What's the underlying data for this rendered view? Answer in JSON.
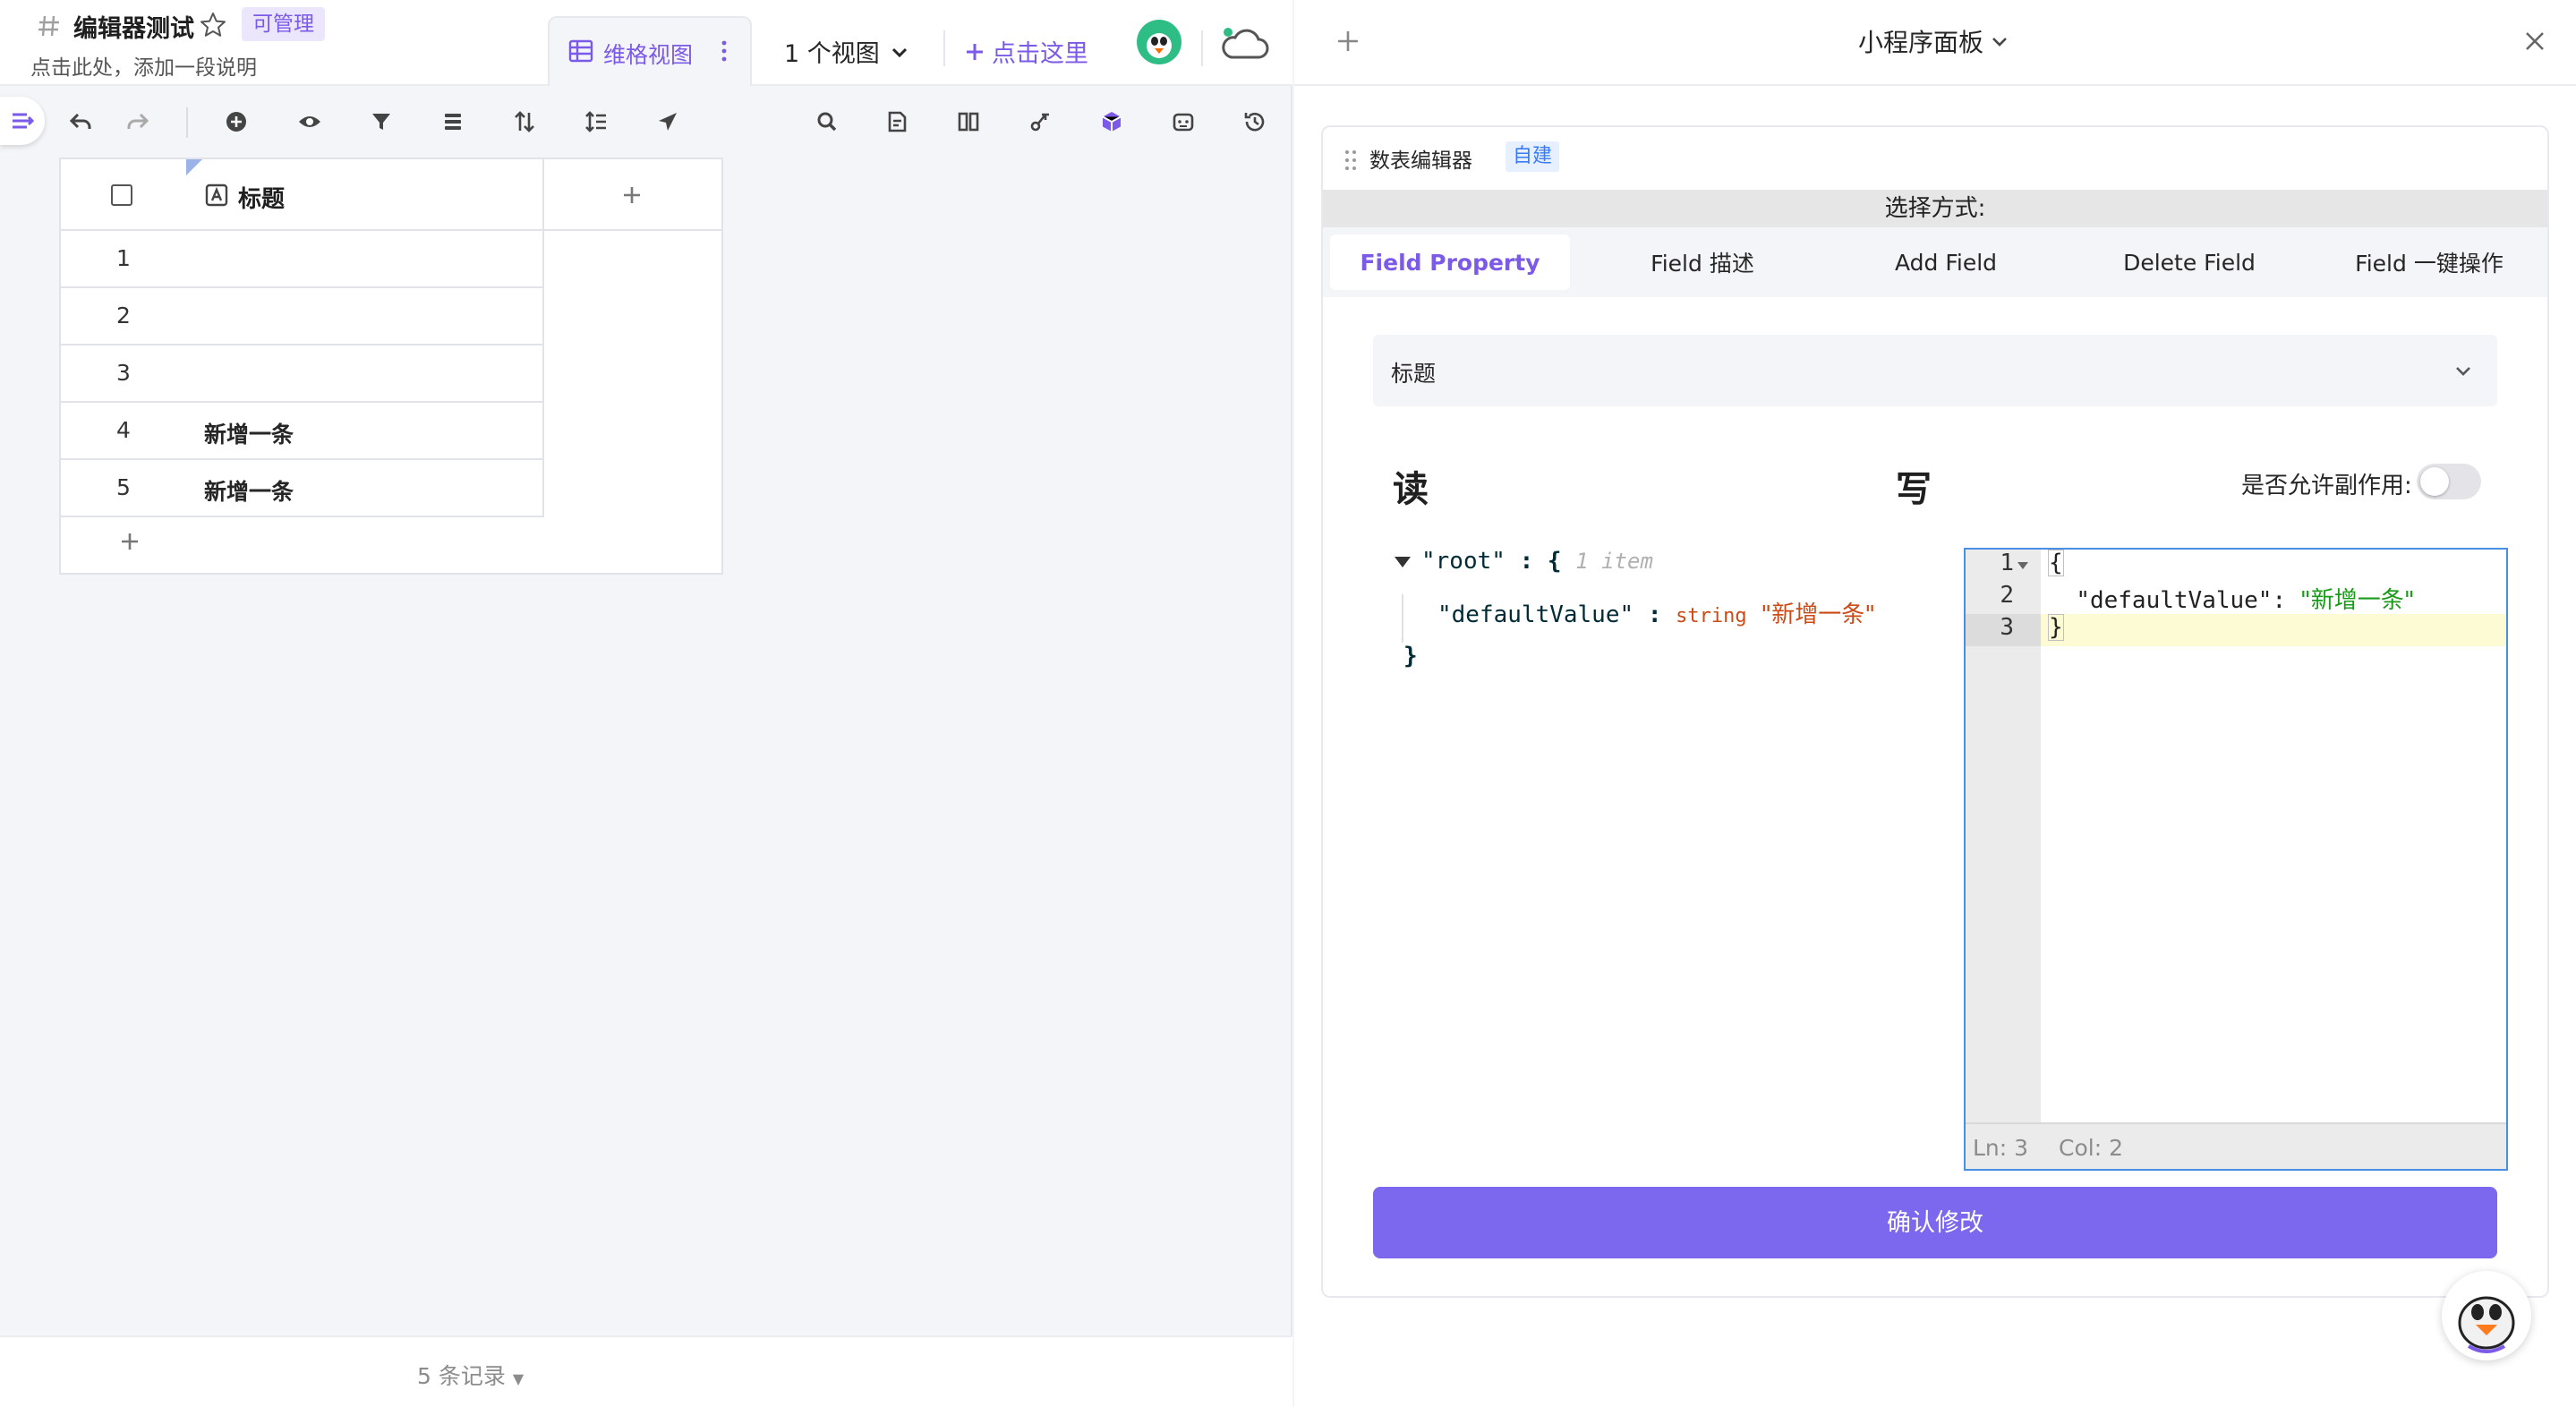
{
  "header": {
    "doc_title": "编辑器测试",
    "manage_badge": "可管理",
    "doc_description": "点击此处，添加一段说明",
    "view_tab_label": "维格视图",
    "views_count": "1 个视图",
    "click_here": "点击这里"
  },
  "table": {
    "column_title": "标题",
    "rows": [
      {
        "num": "1",
        "text": ""
      },
      {
        "num": "2",
        "text": ""
      },
      {
        "num": "3",
        "text": ""
      },
      {
        "num": "4",
        "text": "新增一条"
      },
      {
        "num": "5",
        "text": "新增一条"
      }
    ]
  },
  "footer": {
    "records": "5 条记录"
  },
  "panel": {
    "title": "小程序面板",
    "card_label": "数表编辑器",
    "self_built_badge": "自建",
    "choose_mode": "选择方式:",
    "tabs": [
      {
        "label": "Field Property",
        "active": true
      },
      {
        "label": "Field 描述",
        "active": false
      },
      {
        "label": "Add Field",
        "active": false
      },
      {
        "label": "Delete Field",
        "active": false
      },
      {
        "label": "Field 一键操作",
        "active": false
      }
    ],
    "field_select_value": "标题",
    "read_heading": "读",
    "write_heading": "写",
    "side_effect_label": "是否允许副作用:",
    "side_effect_enabled": false,
    "json_view": {
      "root_key": "\"root\"",
      "root_open": ": {",
      "item_count": "1 item",
      "child_key": "\"defaultValue\"",
      "colon": ":",
      "child_type": "string",
      "child_value": "\"新增一条\"",
      "root_close": "}"
    },
    "editor": {
      "line_numbers": [
        "1",
        "2",
        "3"
      ],
      "lines": [
        "{",
        "  \"defaultValue\": ",
        "}"
      ],
      "line2_key": "\"defaultValue\":",
      "line2_value": "\"新增一条\"",
      "status_ln": "Ln: 3",
      "status_col": "Col: 2"
    },
    "confirm_button": "确认修改"
  },
  "colors": {
    "accent": "#7b5ae8",
    "confirm_button": "#7b68ee",
    "editor_border": "#4a90e2"
  }
}
